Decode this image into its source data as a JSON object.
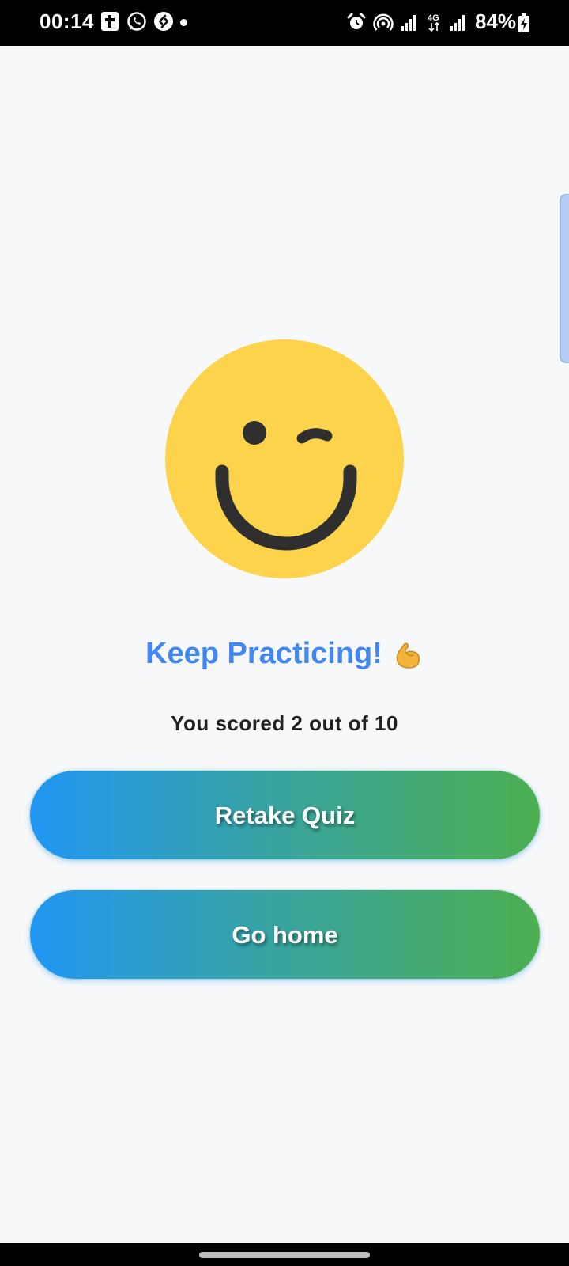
{
  "status_bar": {
    "time": "00:14",
    "battery": "84%",
    "network": "4G",
    "left_icons": [
      "bible-app-icon",
      "whatsapp-icon",
      "shazam-icon",
      "notification-dot"
    ],
    "right_icons": [
      "alarm-icon",
      "hotspot-icon",
      "signal-icon",
      "signal-icon",
      "battery-charging-icon"
    ]
  },
  "result": {
    "emoji": "winking-face",
    "headline": "Keep Practicing!",
    "headline_emoji": "flexed-biceps",
    "score_text": "You scored 2 out of 10"
  },
  "actions": {
    "retake_label": "Retake Quiz",
    "home_label": "Go home"
  },
  "colors": {
    "headline": "#4286f2",
    "gradient_start": "#2196f3",
    "gradient_end": "#4caf50",
    "face": "#fed34c",
    "face_features": "#2f2f2f",
    "background": "#f7f8fa"
  }
}
